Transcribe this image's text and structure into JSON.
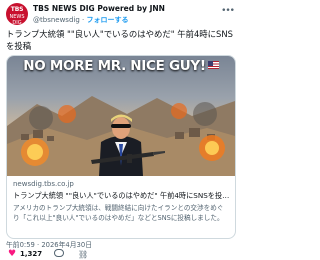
{
  "header": {
    "account_name": "TBS NEWS DIG Powered by JNN",
    "handle": "@tbsnewsdig",
    "separator": "·",
    "follow_label": "フォローする",
    "avatar_text_top": "TBS",
    "avatar_text_bottom": "NEWS DIG",
    "more_icon": "more-horizontal-icon"
  },
  "tweet": {
    "text": "トランプ大統領 \"\"良い人\"でいるのはやめだ\" 午前4時にSNSを投稿"
  },
  "card": {
    "image_banner_text": "NO MORE MR. NICE GUY!",
    "domain": "newsdig.tbs.co.jp",
    "title": "トランプ大統領 \"\"良い人\"でいるのはやめだ\" 午前4時にSNSを投稿 | TBS ...",
    "description": "アメリカのトランプ大統領は、戦闘終結に向けたイランとの交渉をめぐり「これ以上\"良い人\"でいるのはやめだ」などとSNSに投稿しました。トランプ大..."
  },
  "meta": {
    "timestamp": "午前0:59 · 2026年4月30日"
  },
  "actions": {
    "like_icon": "heart-icon",
    "like_count": "1,327",
    "reply_icon": "reply-bubble-icon",
    "link_icon": "link-icon"
  },
  "colors": {
    "brand_red": "#c8102e",
    "link_blue": "#1d9bf0",
    "like_pink": "#f91880",
    "secondary_text": "#536471"
  }
}
